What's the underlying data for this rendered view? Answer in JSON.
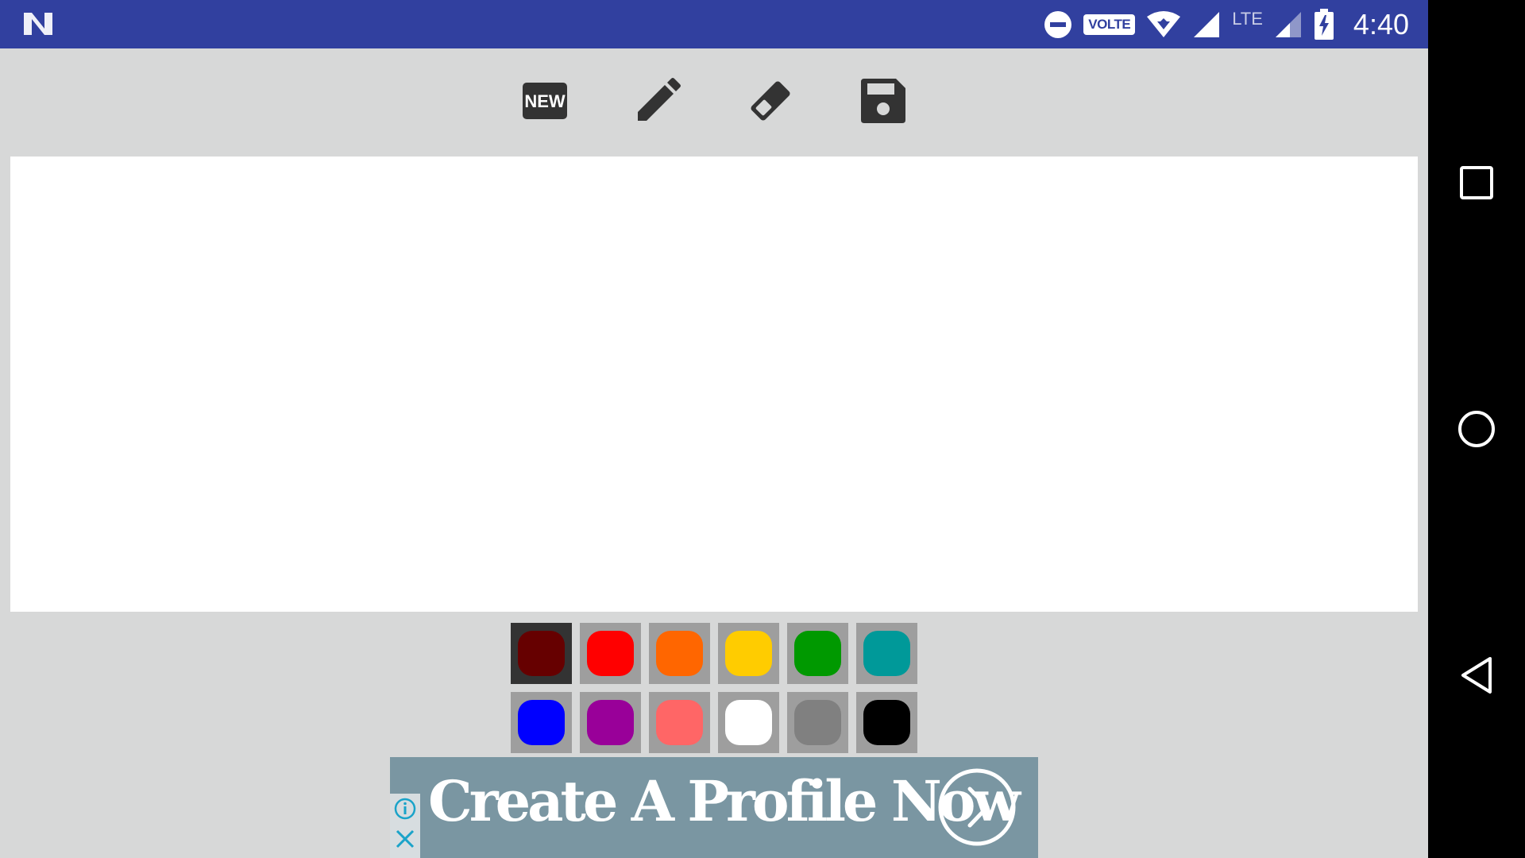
{
  "status_bar": {
    "volte_label": "VOLTE",
    "lte_label": "LTE",
    "time": "4:40",
    "background_color": "#31409f"
  },
  "toolbar": {
    "items": [
      {
        "name": "new",
        "icon": "new-icon",
        "label": "NEW"
      },
      {
        "name": "pencil",
        "icon": "pencil-icon"
      },
      {
        "name": "eraser",
        "icon": "eraser-icon"
      },
      {
        "name": "save",
        "icon": "save-icon"
      }
    ]
  },
  "palette": {
    "selected_index": 0,
    "colors": [
      "#660000",
      "#ff0000",
      "#ff6600",
      "#ffcc00",
      "#009900",
      "#009999",
      "#0000ff",
      "#990099",
      "#ff6666",
      "#ffffff",
      "#808080",
      "#000000"
    ]
  },
  "ad": {
    "headline": "Create A Profile Now",
    "background_color": "#7a96a2"
  },
  "nav_bar": {
    "buttons": [
      "recents-icon",
      "home-icon",
      "back-icon"
    ]
  }
}
